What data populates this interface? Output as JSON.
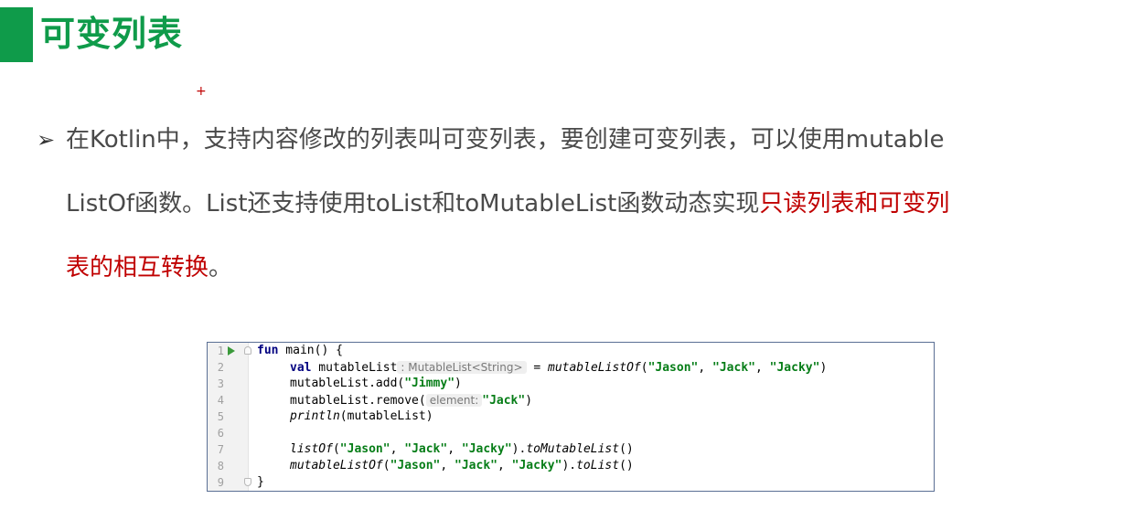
{
  "slide": {
    "title": "可变列表",
    "plus_mark": "+",
    "bullet_symbol": "➢",
    "paragraph": {
      "line1": "在Kotlin中，支持内容修改的列表叫可变列表，要创建可变列表，可以使用mutable",
      "line2_normal": "ListOf函数。List还支持使用toList和toMutableList函数动态实现",
      "line2_red": "只读列表和可变列",
      "line3_red": "表的相互转换",
      "line3_end": "。"
    },
    "colors": {
      "accent_green": "#0f9b4a",
      "highlight_red": "#c00000",
      "body_text": "#4a4a4a"
    }
  },
  "code": {
    "line_numbers": [
      "1",
      "2",
      "3",
      "4",
      "5",
      "6",
      "7",
      "8",
      "9"
    ],
    "l1": {
      "kw": "fun",
      "rest": " main() {"
    },
    "l2": {
      "kw": "val",
      "name": " mutableList",
      "hint": ": MutableList<String>",
      "eq": " = ",
      "fn": "mutableListOf",
      "p1": "(",
      "s1": "\"Jason\"",
      "c1": ", ",
      "s2": "\"Jack\"",
      "c2": ", ",
      "s3": "\"Jacky\"",
      "p2": ")"
    },
    "l3": {
      "pre": "mutableList.add(",
      "s1": "\"Jimmy\"",
      "post": ")"
    },
    "l4": {
      "pre": "mutableList.remove(",
      "hint": "element:",
      "s1": "\"Jack\"",
      "post": ")"
    },
    "l5": {
      "fn": "println",
      "rest": "(mutableList)"
    },
    "l7": {
      "fn": "listOf",
      "p1": "(",
      "s1": "\"Jason\"",
      "c1": ", ",
      "s2": "\"Jack\"",
      "c2": ", ",
      "s3": "\"Jacky\"",
      "p2": ").",
      "fn2": "toMutableList",
      "end": "()"
    },
    "l8": {
      "fn": "mutableListOf",
      "p1": "(",
      "s1": "\"Jason\"",
      "c1": ", ",
      "s2": "\"Jack\"",
      "c2": ", ",
      "s3": "\"Jacky\"",
      "p2": ").",
      "fn2": "toList",
      "end": "()"
    },
    "l9": {
      "rest": "}"
    },
    "icons": {
      "run": "run-arrow-icon",
      "fold": "fold-marker-icon"
    }
  }
}
